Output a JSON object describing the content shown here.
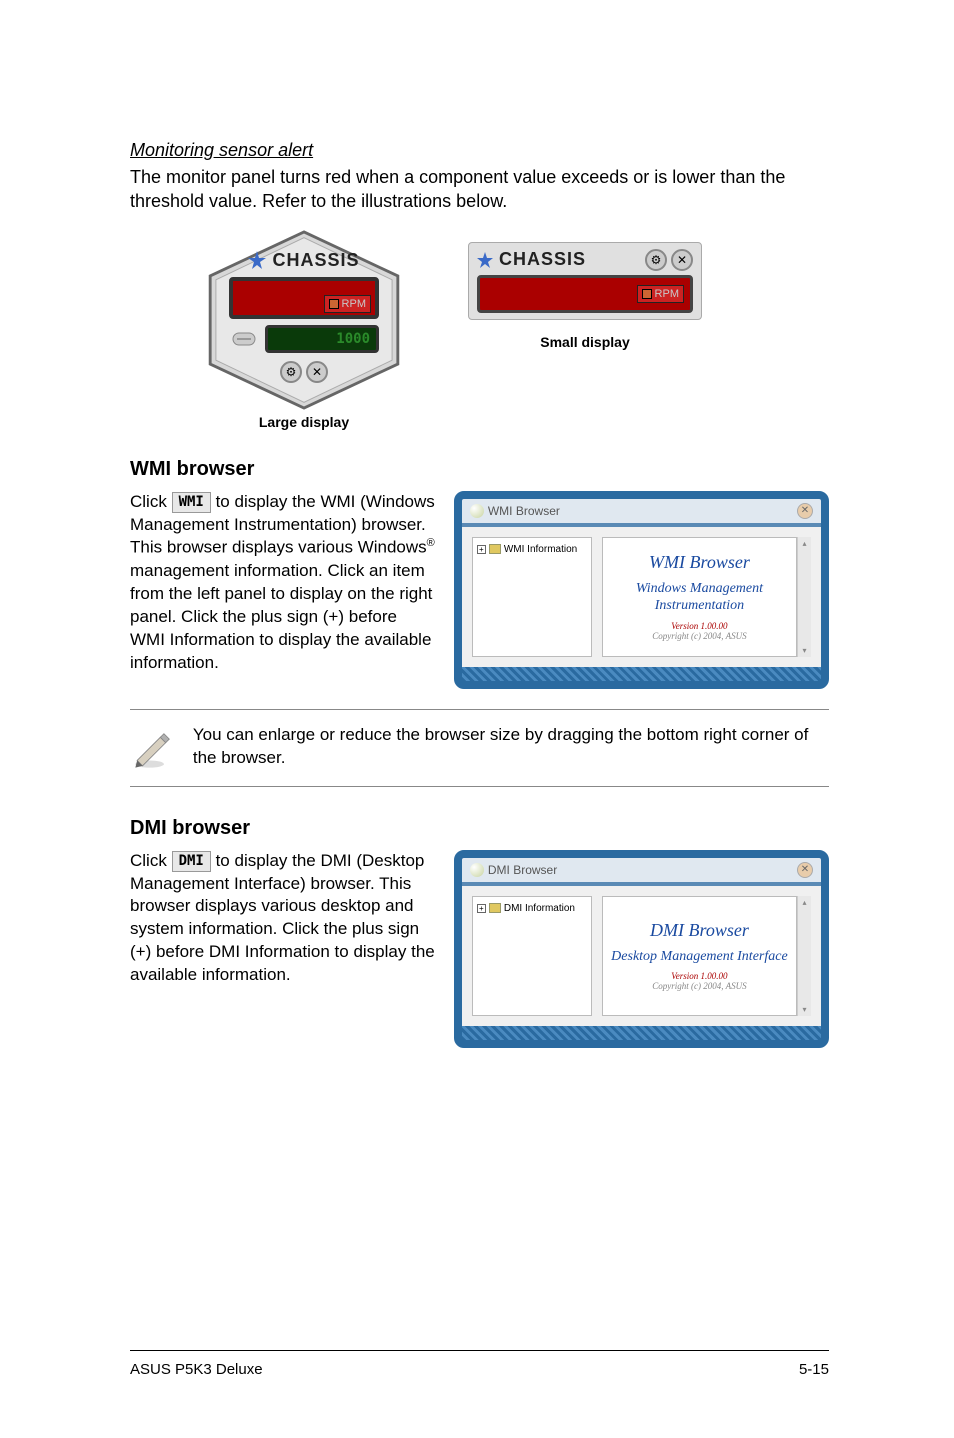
{
  "sensor": {
    "heading": "Monitoring sensor alert",
    "body": "The monitor panel turns red when a component value exceeds or is lower than the threshold value. Refer to the illustrations below.",
    "large": {
      "title": "CHASSIS",
      "rpm_label": "RPM",
      "threshold": "1000",
      "caption": "Large display"
    },
    "small": {
      "title": "CHASSIS",
      "rpm_label": "RPM",
      "caption": "Small display"
    }
  },
  "wmi": {
    "heading": "WMI browser",
    "text_pre": "Click ",
    "btn": "WMI",
    "text_post_a": " to display the WMI (Windows Management Instrumentation) browser. This browser displays various Windows",
    "super": "®",
    "text_post_b": " management information. Click an item from the left panel to display on the right panel. Click the plus sign (+) before WMI Information to display the available information.",
    "browser": {
      "titlebar": "WMI Browser",
      "tree": "WMI Information",
      "title": "WMI Browser",
      "sub": "Windows Management Instrumentation",
      "ver": "Version 1.00.00",
      "copy": "Copyright (c) 2004, ASUS"
    }
  },
  "note": "You can enlarge or reduce the browser size by dragging the bottom right corner of the browser.",
  "dmi": {
    "heading": "DMI browser",
    "text_pre": "Click ",
    "btn": "DMI",
    "text_post": " to display the DMI (Desktop Management Interface) browser. This browser displays various desktop and system information. Click the plus sign (+) before DMI Information to display the available information.",
    "browser": {
      "titlebar": "DMI Browser",
      "tree": "DMI Information",
      "title": "DMI Browser",
      "sub": "Desktop Management Interface",
      "ver": "Version 1.00.00",
      "copy": "Copyright (c) 2004, ASUS"
    }
  },
  "footer": {
    "left": "ASUS P5K3 Deluxe",
    "right": "5-15"
  }
}
